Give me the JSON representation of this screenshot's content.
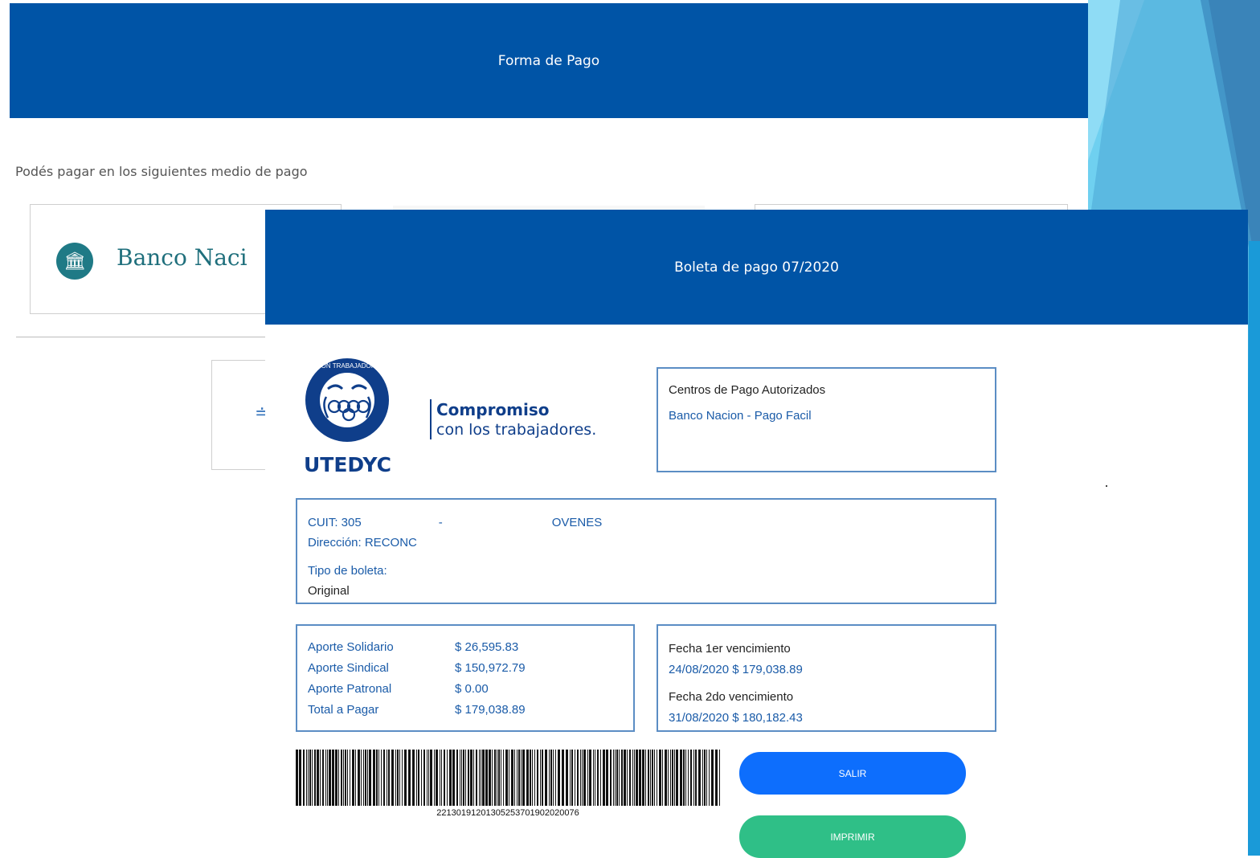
{
  "back_modal": {
    "title": "Forma de Pago",
    "intro": "Podés pagar en los siguientes medio de pago",
    "bank_card_label": "Banco Naci"
  },
  "front_modal": {
    "title": "Boleta de pago 07/2020",
    "logo": {
      "name": "UTEDYC",
      "seal_text": "UNION TRABAJADORES DE ENTIDADES DEPORTIVAS Y CIVILES",
      "slogan_bold": "Compromiso",
      "slogan_rest": "con los trabajadores."
    },
    "centros": {
      "title": "Centros de Pago Autorizados",
      "value": "Banco Nacion - Pago Facil"
    },
    "info": {
      "cuit_label": "CUIT: 305",
      "cuit_sep": "-",
      "name_tail": "OVENES",
      "direccion_label": "Dirección: RECONC",
      "tipo_label": "Tipo de boleta:",
      "tipo_value": "Original"
    },
    "aportes": [
      {
        "label": "Aporte Solidario",
        "value": "$ 26,595.83"
      },
      {
        "label": "Aporte Sindical",
        "value": "$ 150,972.79"
      },
      {
        "label": "Aporte Patronal",
        "value": "$ 0.00"
      },
      {
        "label": "Total a Pagar",
        "value": "$ 179,038.89"
      }
    ],
    "vencimientos": {
      "first_label": "Fecha 1er vencimiento",
      "first_value": "24/08/2020 $ 179,038.89",
      "second_label": "Fecha 2do vencimiento",
      "second_value": "31/08/2020 $ 180,182.43"
    },
    "barcode_number": "22130191201305253701902020076",
    "buttons": {
      "salir": "SALIR",
      "imprimir": "IMPRIMIR"
    }
  },
  "colors": {
    "header_blue": "#0054a6",
    "text_blue": "#1a5ba8",
    "salir_blue": "#0d6efd",
    "imprimir_green": "#2fbf87"
  }
}
